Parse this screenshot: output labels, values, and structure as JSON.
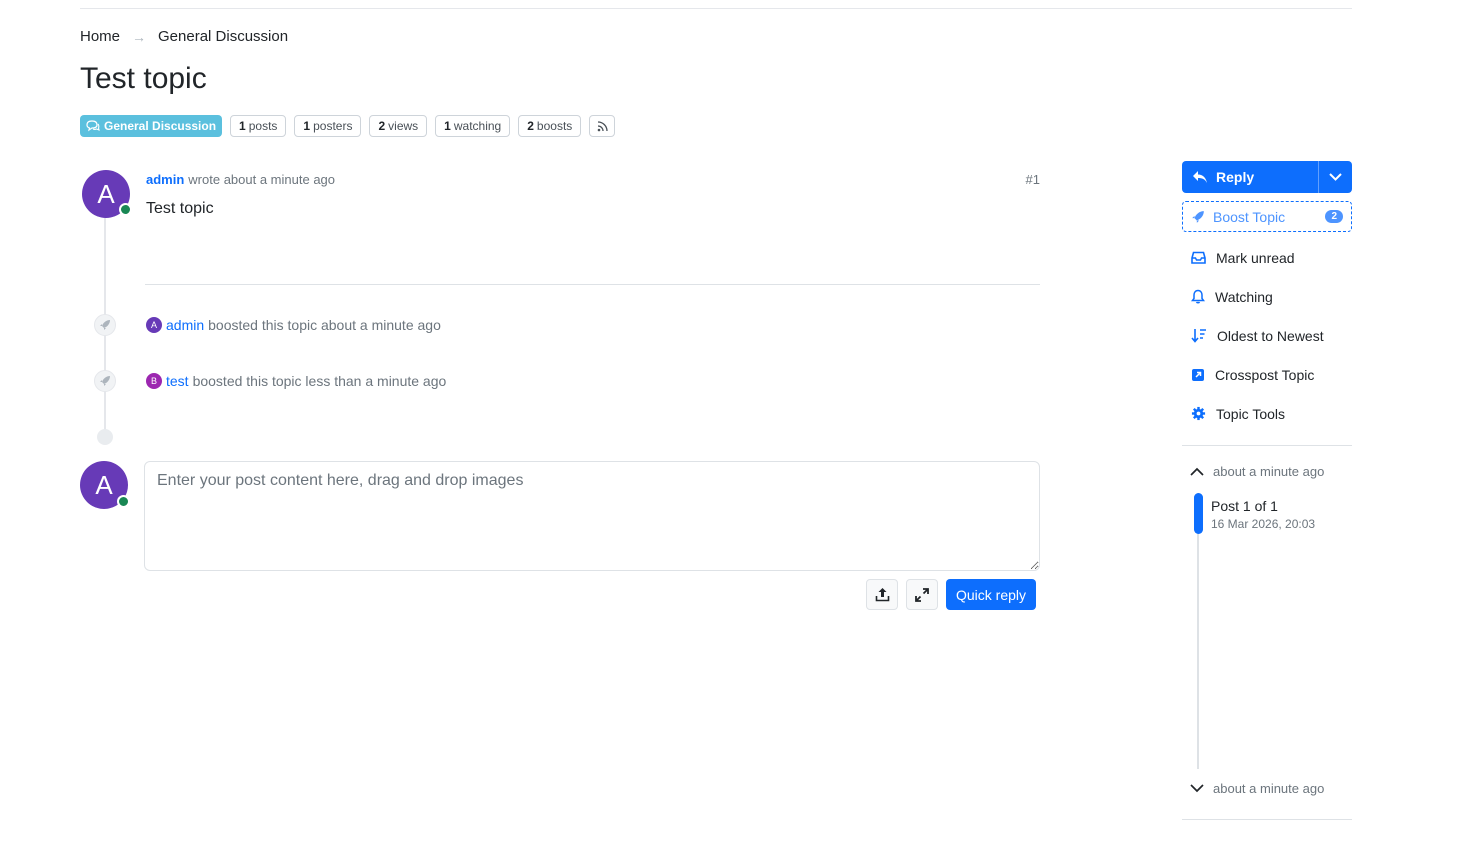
{
  "breadcrumb": {
    "home": "Home",
    "separator": "→",
    "category": "General Discussion"
  },
  "topic": {
    "title": "Test topic"
  },
  "tags": {
    "category_label": "General Discussion",
    "category_color": "#5bc0de",
    "stats": [
      {
        "count": "1",
        "label": "posts"
      },
      {
        "count": "1",
        "label": "posters"
      },
      {
        "count": "2",
        "label": "views"
      },
      {
        "count": "1",
        "label": "watching"
      },
      {
        "count": "2",
        "label": "boosts"
      }
    ]
  },
  "post": {
    "avatar_letter": "A",
    "avatar_color": "#673ab7",
    "author": "admin",
    "meta": "wrote about a minute ago",
    "index": "#1",
    "body": "Test topic"
  },
  "events": [
    {
      "avatar_letter": "A",
      "avatar_color": "#673ab7",
      "user": "admin",
      "text": "boosted this topic about a minute ago"
    },
    {
      "avatar_letter": "B",
      "avatar_color": "#9c27b0",
      "user": "test",
      "text": "boosted this topic less than a minute ago"
    }
  ],
  "composer": {
    "avatar_letter": "A",
    "placeholder": "Enter your post content here, drag and drop images",
    "quick_reply_label": "Quick reply"
  },
  "sidebar": {
    "reply_label": "Reply",
    "boost_label": "Boost Topic",
    "boost_count": "2",
    "items": [
      {
        "label": "Mark unread",
        "icon": "inbox-icon"
      },
      {
        "label": "Watching",
        "icon": "bell-icon"
      },
      {
        "label": "Oldest to Newest",
        "icon": "sort-icon"
      },
      {
        "label": "Crosspost Topic",
        "icon": "crosspost-icon"
      },
      {
        "label": "Topic Tools",
        "icon": "gear-icon"
      }
    ]
  },
  "navigator": {
    "top_label": "about a minute ago",
    "post_label": "Post 1 of 1",
    "post_date": "16 Mar 2026, 20:03",
    "bottom_label": "about a minute ago",
    "progress": 1.0
  }
}
